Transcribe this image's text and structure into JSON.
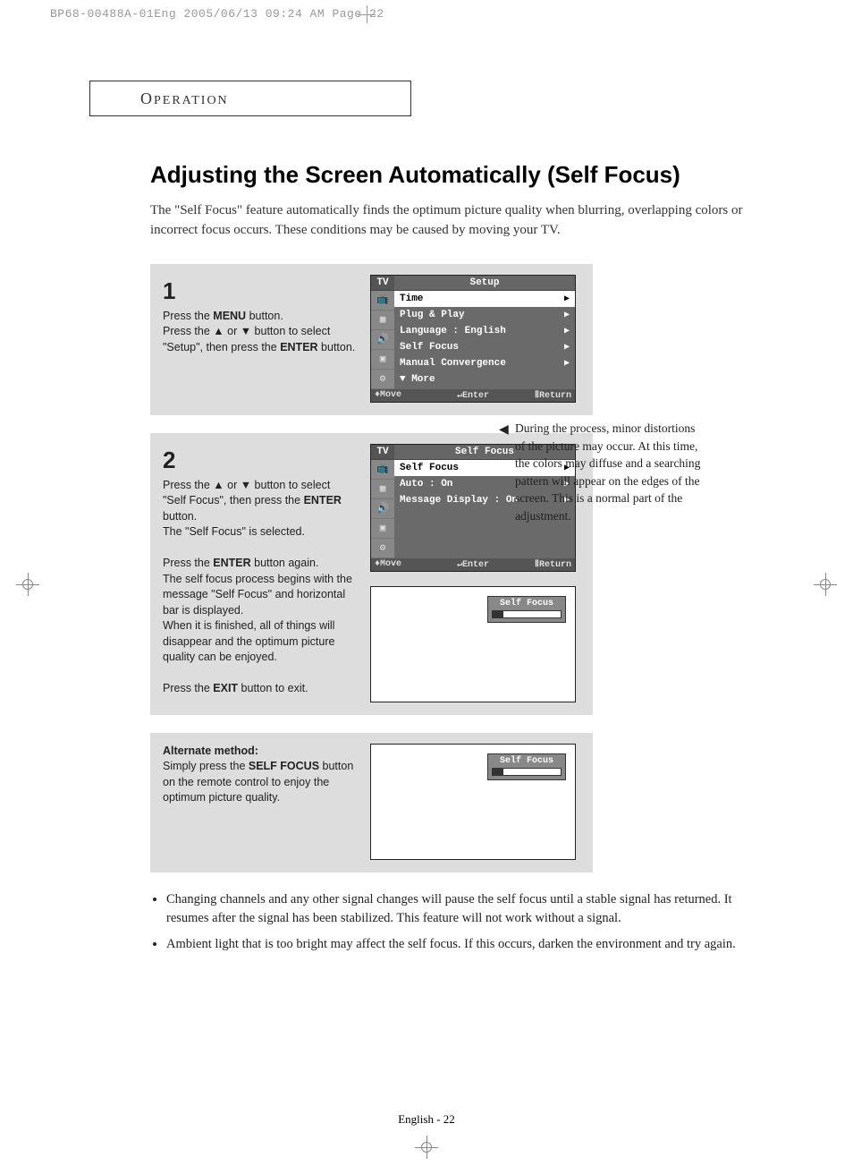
{
  "print_header": "BP68-00488A-01Eng  2005/06/13  09:24 AM  Page 22",
  "section": "Operation",
  "title": "Adjusting the Screen Automatically (Self Focus)",
  "intro": "The \"Self Focus\" feature automatically finds the optimum picture quality when blurring, overlapping colors or incorrect focus occurs. These conditions may be caused by moving your TV.",
  "step1": {
    "num": "1",
    "l1": "Press the ",
    "b1": "MENU",
    "l1b": " button.",
    "l2a": "Press the ▲ or ▼ button to select \"Setup\", then press the ",
    "b2": "ENTER",
    "l2b": " button."
  },
  "osd1": {
    "tv": "TV",
    "title": "Setup",
    "items": [
      {
        "label": "Time",
        "selected": true
      },
      {
        "label": "Plug & Play"
      },
      {
        "label": "Language   :   English"
      },
      {
        "label": "Self Focus"
      },
      {
        "label": "Manual Convergence"
      },
      {
        "label": "▼   More"
      }
    ],
    "footer": {
      "move": "Move",
      "enter": "Enter",
      "ret": "Return"
    }
  },
  "step2": {
    "num": "2",
    "p1a": "Press the ▲ or ▼ button to select \"Self Focus\", then press the ",
    "p1b": "ENTER",
    "p1c": " button.",
    "p2": "The \"Self Focus\" is selected.",
    "p3a": "Press the ",
    "p3b": "ENTER",
    "p3c": " button again.",
    "p4": "The self focus process begins with the message \"Self Focus\" and horizontal bar is displayed.",
    "p5": "When it is finished, all of things will disappear and the optimum picture quality can be enjoyed.",
    "p6a": "Press the ",
    "p6b": "EXIT",
    "p6c": " button to exit."
  },
  "osd2": {
    "tv": "TV",
    "title": "Self Focus",
    "items": [
      {
        "label": "Self Focus",
        "selected": true
      },
      {
        "label": "Auto            :  On"
      },
      {
        "label": "Message Display :  On"
      }
    ],
    "footer": {
      "move": "Move",
      "enter": "Enter",
      "ret": "Return"
    }
  },
  "tv_sf_label": "Self Focus",
  "side_note": "During the process, minor distortions of the picture may occur. At this time, the colors may diffuse and a searching pattern will appear on the edges of the screen. This is a normal part of the adjustment.",
  "alt": {
    "h": "Alternate method:",
    "t1": "Simply press the ",
    "b": "SELF FOCUS",
    "t2": " button on the remote control to enjoy the optimum picture quality."
  },
  "bullets": [
    "Changing channels and any other signal changes will pause the self focus until a stable signal has returned. It resumes after the signal has been stabilized. This feature will not work without a signal.",
    "Ambient light that is too bright may affect the self focus. If this occurs, darken the environment and try again."
  ],
  "footer": "English - 22"
}
